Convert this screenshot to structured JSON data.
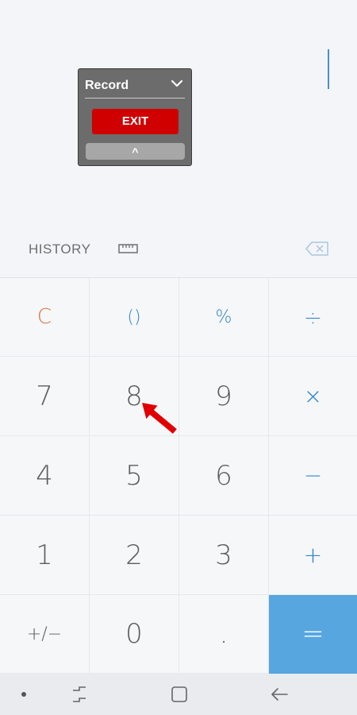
{
  "overlay": {
    "title": "Record",
    "exit_label": "EXIT",
    "collapse_label": "^"
  },
  "toolbar": {
    "history_label": "HISTORY",
    "unit_icon": "ruler-icon",
    "backspace_icon": "backspace-icon"
  },
  "keypad": {
    "row1": [
      "C",
      "()",
      "%",
      "÷"
    ],
    "row2": [
      "7",
      "8",
      "9",
      "×"
    ],
    "row3": [
      "4",
      "5",
      "6",
      "−"
    ],
    "row4": [
      "1",
      "2",
      "3",
      "+"
    ],
    "row5": [
      "+/−",
      "0",
      ".",
      "="
    ]
  },
  "colors": {
    "accent": "#2f86c9",
    "clear": "#e0703f",
    "equals_bg": "#57a6e0",
    "exit_bg": "#d00000",
    "pointer": "#e00000"
  },
  "navbar": {
    "icons": [
      "dot-icon",
      "recent-apps-icon",
      "home-icon",
      "back-icon"
    ]
  }
}
